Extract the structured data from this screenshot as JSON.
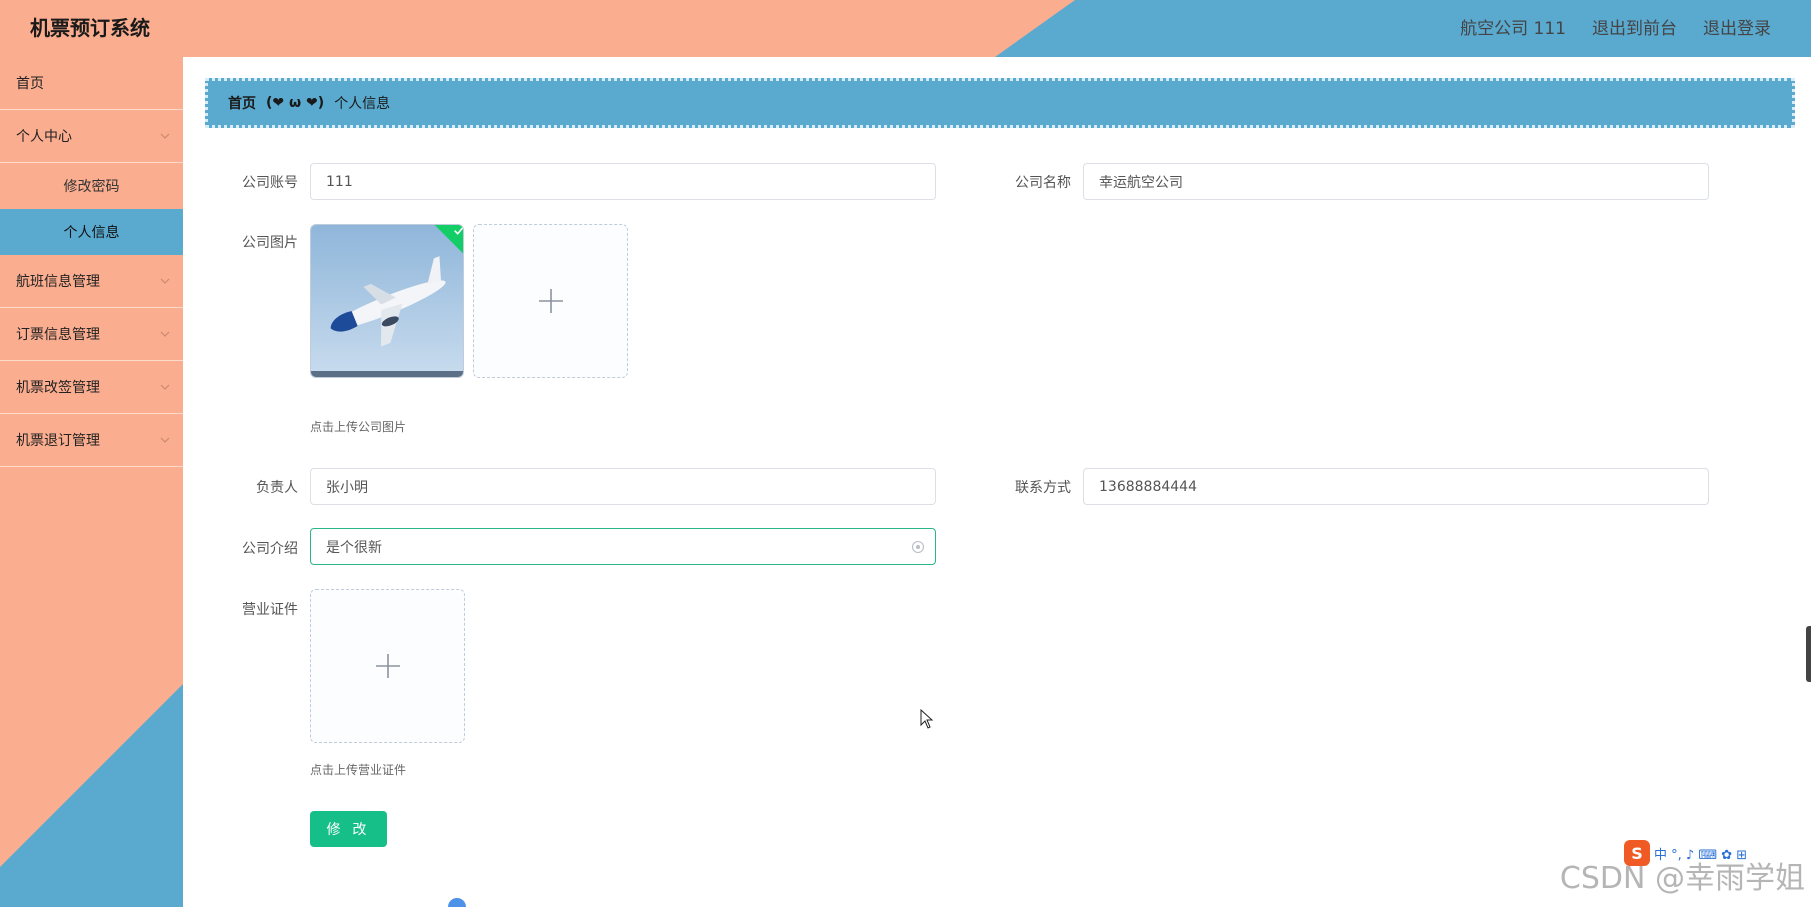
{
  "app": {
    "title": "机票预订系统"
  },
  "header": {
    "nav": [
      "航空公司 111",
      "退出到前台",
      "退出登录"
    ]
  },
  "sidebar": {
    "items": [
      {
        "label": "首页"
      },
      {
        "label": "个人中心",
        "children": [
          "修改密码",
          "个人信息"
        ],
        "active_child": "个人信息"
      },
      {
        "label": "航班信息管理"
      },
      {
        "label": "订票信息管理"
      },
      {
        "label": "机票改签管理"
      },
      {
        "label": "机票退订管理"
      }
    ]
  },
  "breadcrumb": {
    "home": "首页",
    "separator": "(❤ ω ❤)",
    "current": "个人信息"
  },
  "form": {
    "company_account": {
      "label": "公司账号",
      "value": "111"
    },
    "company_name": {
      "label": "公司名称",
      "value": "幸运航空公司"
    },
    "company_image": {
      "label": "公司图片",
      "tip": "点击上传公司图片"
    },
    "manager": {
      "label": "负责人",
      "value": "张小明"
    },
    "contact": {
      "label": "联系方式",
      "value": "13688884444"
    },
    "company_intro": {
      "label": "公司介绍",
      "value": "是个很新"
    },
    "business_license": {
      "label": "营业证件",
      "tip": "点击上传营业证件"
    },
    "submit_label": "修 改"
  },
  "overlay": {
    "watermark": "CSDN @幸雨学姐",
    "ime_text": "中 °, ♪ ⌨ ✿ ⊞",
    "ime_logo": "S"
  },
  "colors": {
    "salmon": "#fbad8f",
    "blue": "#5aa9cf",
    "green": "#16be88"
  }
}
